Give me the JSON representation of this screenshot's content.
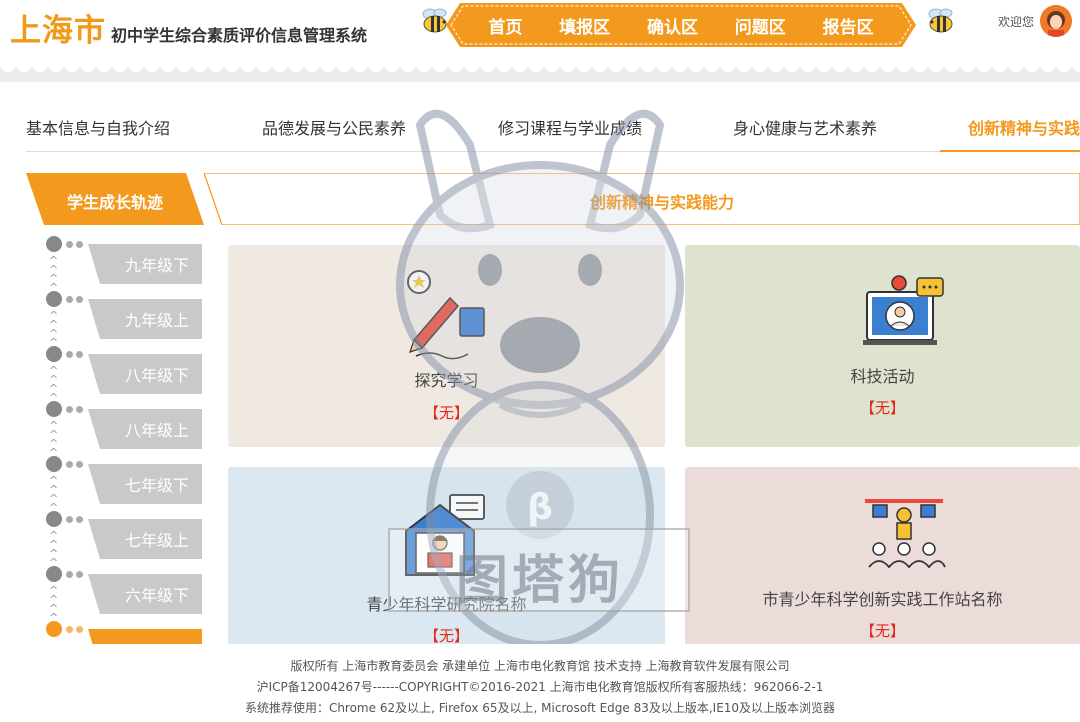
{
  "header": {
    "city": "上海市",
    "system_name": "初中学生综合素质评价信息管理系统",
    "nav": [
      "首页",
      "填报区",
      "确认区",
      "问题区",
      "报告区"
    ],
    "welcome": "欢迎您",
    "accent_color": "#f39a1e"
  },
  "tabs": [
    {
      "label": "基本信息与自我介绍"
    },
    {
      "label": "品德发展与公民素养"
    },
    {
      "label": "修习课程与学业成绩"
    },
    {
      "label": "身心健康与艺术素养"
    },
    {
      "label": "创新精神与实践"
    }
  ],
  "active_tab": 4,
  "sidebar": {
    "title": "学生成长轨迹",
    "grades": [
      "九年级下",
      "九年级上",
      "八年级下",
      "八年级上",
      "七年级下",
      "七年级上",
      "六年级下"
    ]
  },
  "section": {
    "title": "创新精神与实践能力"
  },
  "cards": [
    {
      "title": "探究学习",
      "status": "【无】",
      "icon": "writing-award-icon"
    },
    {
      "title": "科技活动",
      "status": "【无】",
      "icon": "computer-presenter-icon"
    },
    {
      "title": "青少年科学研究院名称",
      "status": "【无】",
      "icon": "reading-student-icon"
    },
    {
      "title": "市青少年科学创新实践工作站名称",
      "status": "【无】",
      "icon": "classroom-icon"
    }
  ],
  "watermark": {
    "text": "图塔狗",
    "badge": "β"
  },
  "footer": {
    "line1": "版权所有 上海市教育委员会    承建单位 上海市电化教育馆    技术支持 上海教育软件发展有限公司",
    "line2": "沪ICP备12004267号------COPYRIGHT©2016-2021 上海市电化教育馆版权所有客服热线：962066-2-1",
    "line3": "系统推荐使用：Chrome 62及以上, Firefox 65及以上, Microsoft Edge 83及以上版本,IE10及以上版本浏览器"
  }
}
